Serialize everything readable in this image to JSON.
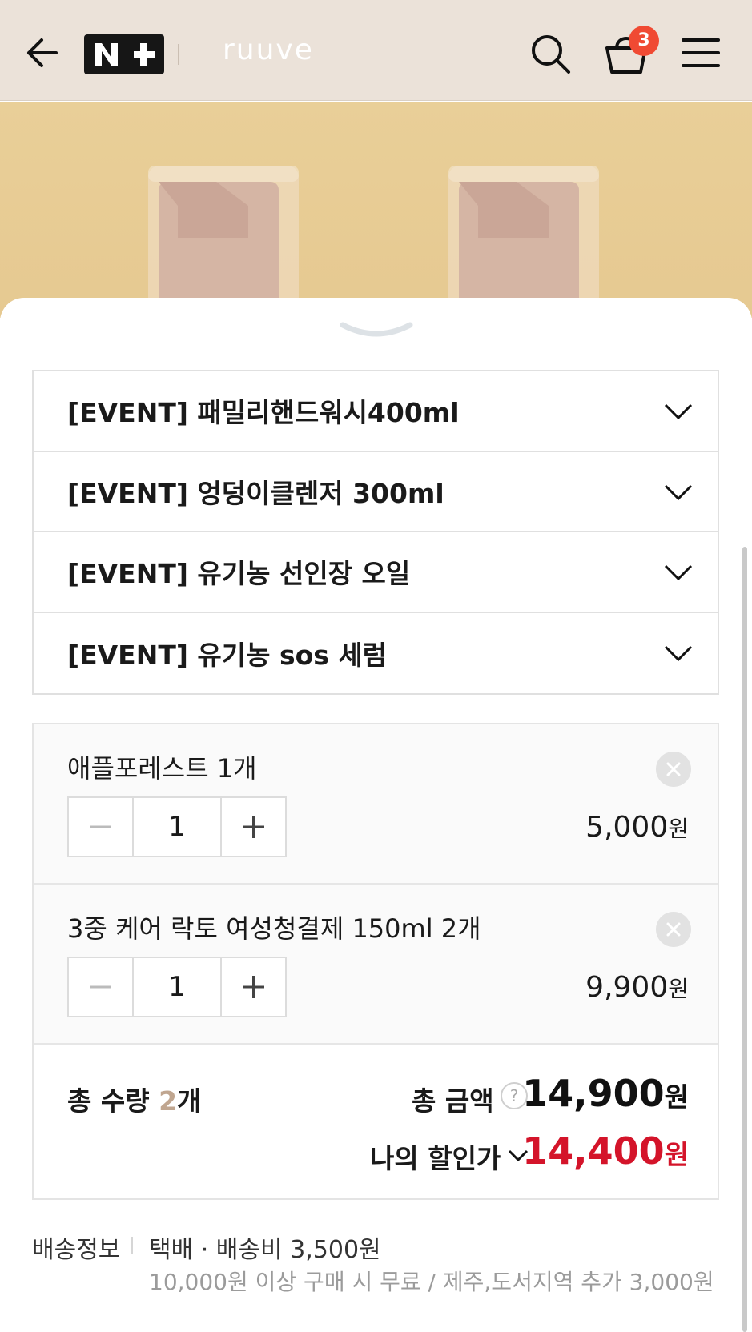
{
  "header": {
    "back_icon": "arrow-left-icon",
    "logo_text": "N+",
    "brand": "ruuve",
    "search_icon": "search-icon",
    "cart_icon": "shopping-bag-icon",
    "cart_count": "3",
    "menu_icon": "hamburger-menu-icon"
  },
  "accordion": {
    "items": [
      {
        "label": "[EVENT] 패밀리핸드워시400ml"
      },
      {
        "label": "[EVENT] 엉덩이클렌저 300ml"
      },
      {
        "label": "[EVENT] 유기농 선인장 오일"
      },
      {
        "label": "[EVENT] 유기농 sos 세럼"
      }
    ]
  },
  "options": {
    "items": [
      {
        "name": "애플포레스트 1개",
        "qty": "1",
        "price": "5,000",
        "currency": "원"
      },
      {
        "name": "3중 케어 락토 여성청결제 150ml 2개",
        "qty": "1",
        "price": "9,900",
        "currency": "원"
      }
    ]
  },
  "summary": {
    "qty_prefix": "총 수량 ",
    "qty_value": "2",
    "qty_suffix": "개",
    "total_label": "총 금액",
    "total_value": "14,900",
    "discount_label": "나의 할인가",
    "discount_value": "14,400",
    "currency": "원"
  },
  "shipping": {
    "label": "배송정보",
    "method": "택배 · 배송비 3,500원",
    "note": "10,000원 이상 구매 시 무료 / 제주,도서지역 추가 3,000원"
  },
  "colors": {
    "header_bg": "#ebe2d9",
    "badge": "#f04a33",
    "discount_price": "#d4142a",
    "qty_accent": "#c0a690"
  }
}
